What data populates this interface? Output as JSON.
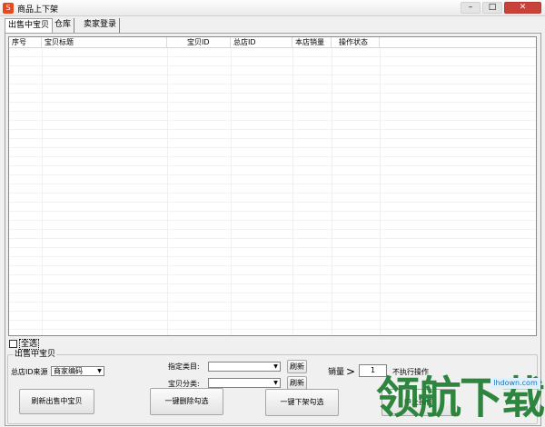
{
  "window": {
    "title": "商品上下架",
    "icon": "app-logo-icon",
    "close_glyph": "✕"
  },
  "tabs": [
    {
      "label": "出售中宝贝",
      "active": true
    },
    {
      "label": "仓库",
      "active": false
    },
    {
      "label": "卖家登录",
      "active": false
    }
  ],
  "table": {
    "columns": [
      "序号",
      "宝贝标题",
      "宝贝ID",
      "总店ID",
      "本店销量",
      "操作状态"
    ],
    "rows": []
  },
  "select_all": {
    "label": "全选",
    "checked": false
  },
  "group": {
    "title": "出售中宝贝",
    "source_label": "总店ID来源",
    "source_value": "商家编码",
    "category_label": "指定类目:",
    "category_value": "",
    "classify_label": "宝贝分类:",
    "classify_value": "",
    "refresh_label_1": "刷新",
    "refresh_label_2": "刷新",
    "sales_label": "销量",
    "sales_op": ">",
    "sales_value": "1",
    "no_exec_label": "不执行操作",
    "btn_refresh_listing": "刷新出售中宝贝",
    "btn_delist_all": "一键删除勾选",
    "btn_delist_checked": "一键下架勾选",
    "btn_stop": "中止操作"
  },
  "watermark": {
    "text": "领航下载",
    "url": "lhdown.com"
  },
  "colors": {
    "close_button": "#c8423a",
    "watermark_green": "#1e7d30",
    "watermark_blue": "#1673b9"
  }
}
